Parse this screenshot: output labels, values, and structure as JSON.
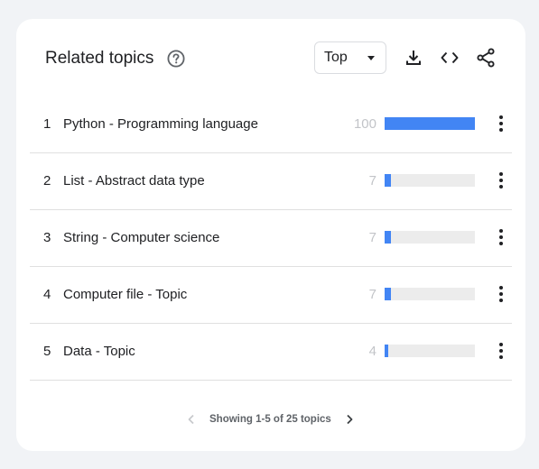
{
  "header": {
    "title": "Related topics",
    "help_icon": "help-circle-icon",
    "dropdown": {
      "selected": "Top"
    },
    "actions": [
      {
        "icon": "download-icon"
      },
      {
        "icon": "embed-code-icon"
      },
      {
        "icon": "share-icon"
      }
    ]
  },
  "list": {
    "items": [
      {
        "rank": "1",
        "name": "Python - Programming language",
        "value": "100",
        "level": 100
      },
      {
        "rank": "2",
        "name": "List - Abstract data type",
        "value": "7",
        "level": 7
      },
      {
        "rank": "3",
        "name": "String - Computer science",
        "value": "7",
        "level": 7
      },
      {
        "rank": "4",
        "name": "Computer file - Topic",
        "value": "7",
        "level": 7
      },
      {
        "rank": "5",
        "name": "Data - Topic",
        "value": "4",
        "level": 4
      }
    ],
    "max_level": 100,
    "more_icon": "more-vertical-icon"
  },
  "pagination": {
    "text": "Showing 1-5 of 25 topics",
    "prev_icon": "chevron-left-icon",
    "next_icon": "chevron-right-icon"
  },
  "colors": {
    "bar": "#4285f4",
    "track": "#ececec",
    "background": "#f1f3f6",
    "card": "#ffffff"
  }
}
